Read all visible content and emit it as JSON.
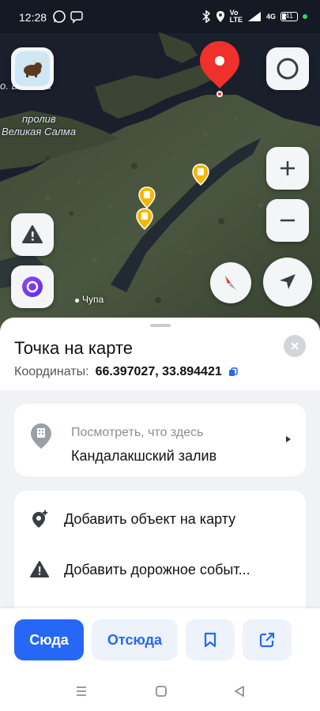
{
  "status_bar": {
    "time": "12:28",
    "battery_level": "41",
    "network_labels": [
      "Vo",
      "LTE",
      "4G"
    ]
  },
  "map": {
    "labels": {
      "island": "о. Великий",
      "strait_line1": "пролив",
      "strait_line2": "Великая Салма",
      "town": "Чупа"
    },
    "controls": {
      "zoom_in": "plus-icon",
      "zoom_out": "minus-icon",
      "layers": "layers-icon",
      "road_alert": "warning-icon",
      "alice": "alice-icon",
      "compass": "compass-icon",
      "locate": "navigate-icon"
    }
  },
  "sheet": {
    "title": "Точка на карте",
    "coords_label": "Координаты:",
    "coords_value": "66.397027, 33.894421",
    "whats_here": {
      "hint": "Посмотреть, что здесь",
      "place": "Кандалакшский залив"
    },
    "actions": [
      {
        "label": "Добавить объект на карту",
        "icon": "add-place-icon"
      },
      {
        "label": "Добавить дорожное событ...",
        "icon": "warning-icon"
      }
    ]
  },
  "action_bar": {
    "here": "Сюда",
    "from": "Отсюда",
    "bookmark_icon": "bookmark-icon",
    "share_icon": "share-icon"
  },
  "colors": {
    "accent": "#2668f5",
    "pin_red": "#f0302a",
    "poi_yellow": "#f5b800"
  }
}
